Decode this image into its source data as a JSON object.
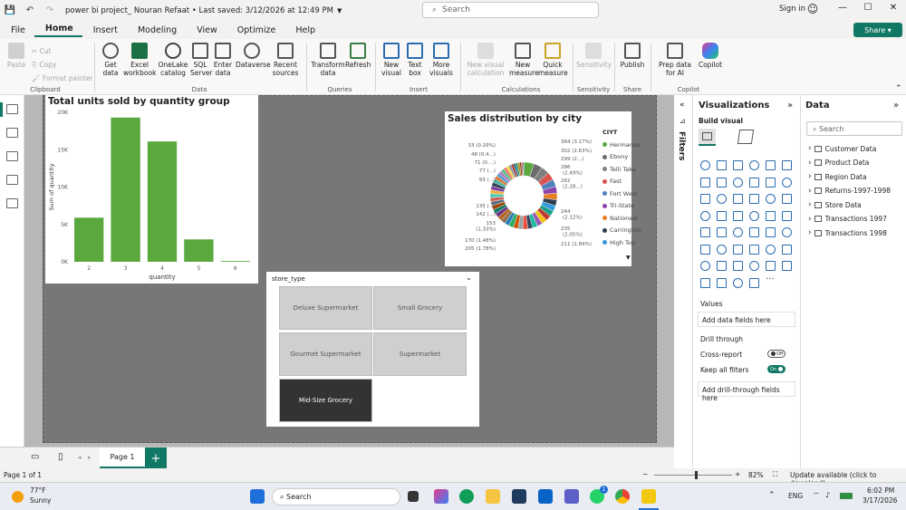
{
  "titlebar": {
    "title": "power bi project_ Nouran Refaat  •  Last saved: 3/12/2026 at 12:49 PM",
    "search_placeholder": "Search",
    "signin": "Sign in"
  },
  "menu": {
    "items": [
      "File",
      "Home",
      "Insert",
      "Modeling",
      "View",
      "Optimize",
      "Help"
    ],
    "active": "Home",
    "share": "Share"
  },
  "ribbon": {
    "paste": "Paste",
    "cut": "Cut",
    "copy": "Copy",
    "format_painter": "Format painter",
    "get_data": "Get data",
    "excel": "Excel workbook",
    "onelake": "OneLake catalog",
    "sql": "SQL Server",
    "enter_data": "Enter data",
    "dataverse": "Dataverse",
    "recent": "Recent sources",
    "transform": "Transform data",
    "refresh": "Refresh",
    "new_visual": "New visual",
    "text_box": "Text box",
    "more_visuals": "More visuals",
    "new_visual_calc": "New visual calculation",
    "new_measure": "New measure",
    "quick_measure": "Quick measure",
    "sensitivity": "Sensitivity",
    "publish": "Publish",
    "prep_data": "Prep data for AI",
    "copilot": "Copilot",
    "groups": [
      "Clipboard",
      "Data",
      "Queries",
      "Insert",
      "Calculations",
      "Sensitivity",
      "Share",
      "Copilot"
    ]
  },
  "bar_chart": {
    "chart_data": {
      "type": "bar",
      "title": "Total units sold by quantity group",
      "xlabel": "quantity",
      "ylabel": "Sum of quantity",
      "categories": [
        "2",
        "3",
        "4",
        "5",
        "6"
      ],
      "values": [
        5900,
        19300,
        16100,
        3000,
        100
      ],
      "yticks": [
        "0K",
        "5K",
        "10K",
        "15K",
        "20K"
      ],
      "ylim": [
        0,
        20000
      ],
      "color": "#5aa83e",
      "grid": false
    }
  },
  "donut_chart": {
    "chart_data": {
      "type": "pie",
      "title": "Sales distribution by city",
      "legend_title": "CIYT",
      "legend_position": "right",
      "legend": [
        {
          "name": "Hermanos",
          "color": "#5aa83e"
        },
        {
          "name": "Ebony",
          "color": "#6b6b6b"
        },
        {
          "name": "Telli Take",
          "color": "#7f7f7f"
        },
        {
          "name": "Fast",
          "color": "#d9534f"
        },
        {
          "name": "Fort West",
          "color": "#4f81bd"
        },
        {
          "name": "Tri-State",
          "color": "#8e44ad"
        },
        {
          "name": "Nationeel",
          "color": "#e67e22"
        },
        {
          "name": "Carrington",
          "color": "#2c3e50"
        },
        {
          "name": "High Top",
          "color": "#3498db"
        }
      ],
      "labels_right": [
        "364 (3.17%)",
        "302 (2.63%)",
        "299 (2...)",
        "286 (2.49%)",
        "262 (2.28...)",
        "244 (2.12%)",
        "235 (2.05%)",
        "211 (1.84%)"
      ],
      "labels_left": [
        "33 (0.29%)",
        "48 (0.4...)",
        "71 (0....)",
        "77 (...)",
        "93 (...)",
        "135 (...)",
        "142 (...)",
        "153 (1.33%)",
        "170 (1.48%)",
        "205 (1.78%)"
      ],
      "segments": [
        364,
        302,
        299,
        286,
        262,
        244,
        235,
        211,
        205,
        200,
        195,
        190,
        185,
        180,
        178,
        175,
        172,
        170,
        168,
        165,
        160,
        158,
        155,
        153,
        150,
        148,
        145,
        142,
        140,
        138,
        135,
        130,
        125,
        120,
        115,
        110,
        105,
        100,
        93,
        88,
        80,
        77,
        71,
        60,
        48,
        33
      ]
    }
  },
  "slicer": {
    "title": "store_type",
    "items": [
      "Deluxe Supermarket",
      "Small Grocery",
      "Gourmet Supermarket",
      "Supermarket",
      "Mid-Size Grocery"
    ],
    "selected": "Mid-Size Grocery"
  },
  "filters": {
    "label": "Filters"
  },
  "viz_pane": {
    "title": "Visualizations",
    "build_visual": "Build visual",
    "values_label": "Values",
    "add_fields": "Add data fields here",
    "drill_through": "Drill through",
    "cross_report": "Cross-report",
    "cross_report_state": "Off",
    "keep_filters": "Keep all filters",
    "keep_filters_state": "On",
    "add_drill": "Add drill-through fields here"
  },
  "data_pane": {
    "title": "Data",
    "search_placeholder": "Search",
    "tables": [
      "Customer Data",
      "Product Data",
      "Region Data",
      "Returns-1997-1998",
      "Store Data",
      "Transactions 1997",
      "Transactions 1998"
    ]
  },
  "bottom": {
    "page_tab": "Page 1",
    "page_info": "Page 1 of 1",
    "zoom": "82%",
    "update": "Update available (click to download)"
  },
  "taskbar": {
    "weather_temp": "77°F",
    "weather_desc": "Sunny",
    "search": "Search",
    "lang": "ENG",
    "time": "6:02 PM",
    "date": "3/17/2026",
    "badge": "1"
  }
}
